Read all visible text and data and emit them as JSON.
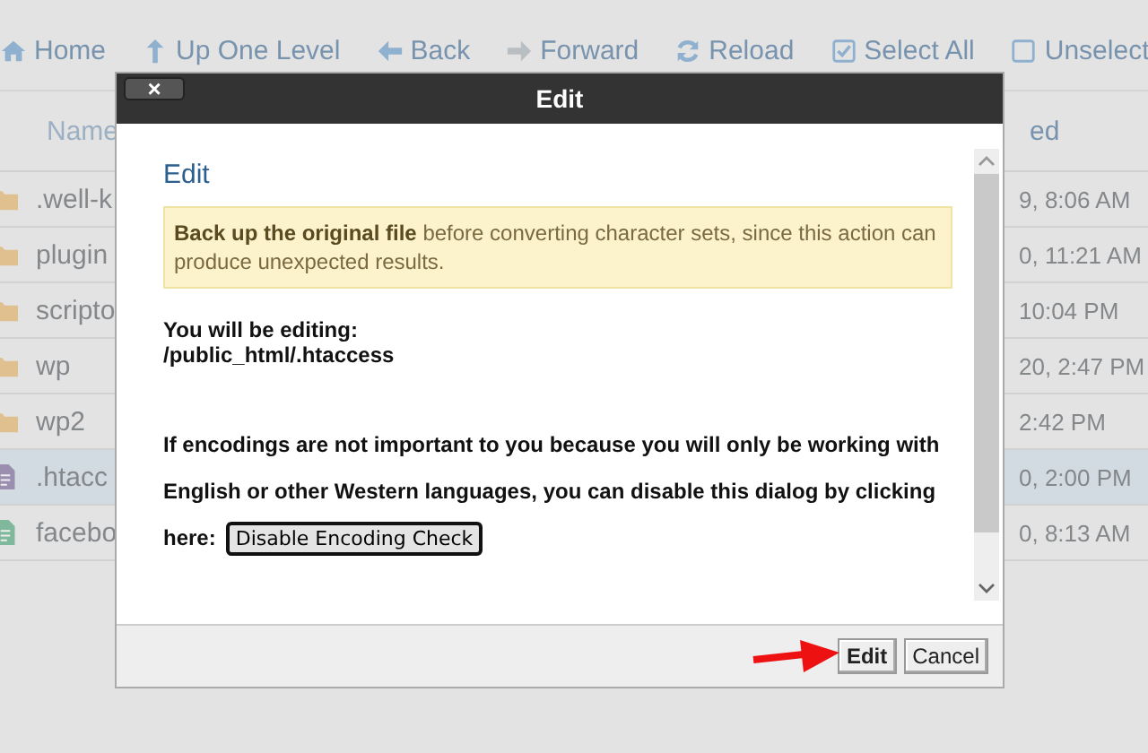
{
  "toolbar": [
    {
      "label": "Home"
    },
    {
      "label": "Up One Level"
    },
    {
      "label": "Back"
    },
    {
      "label": "Forward"
    },
    {
      "label": "Reload"
    },
    {
      "label": "Select All"
    },
    {
      "label": "Unselect"
    }
  ],
  "table": {
    "columns": [
      "Name",
      "ed"
    ],
    "rows": [
      {
        "kind": "folder",
        "name": ".well-k",
        "date": "9, 8:06 AM",
        "selected": false
      },
      {
        "kind": "folder",
        "name": "plugin",
        "date": "0, 11:21 AM",
        "selected": false
      },
      {
        "kind": "folder",
        "name": "scripto",
        "date": "10:04 PM",
        "selected": false
      },
      {
        "kind": "folder",
        "name": "wp",
        "date": "20, 2:47 PM",
        "selected": false
      },
      {
        "kind": "folder",
        "name": "wp2",
        "date": "2:42 PM",
        "selected": false
      },
      {
        "kind": "file",
        "color": "#9b8fb0",
        "name": ".htacc",
        "date": "0, 2:00 PM",
        "selected": true
      },
      {
        "kind": "file",
        "color": "#7fb89a",
        "name": "facebo",
        "date": "0, 8:13 AM",
        "selected": false
      }
    ]
  },
  "dialog": {
    "title": "Edit",
    "close": "×",
    "heading": "Edit",
    "notice": "**Back up the original file** before converting character sets, since this action can produce unexpected results.",
    "editing_label": "You will be editing:",
    "editing_path": "/public_html/.htaccess",
    "encoding_text": "If encodings are not important to you because you will only be working with English or other Western languages, you can disable this dialog by clicking",
    "encoding_text_end": "here:",
    "encoding_button": "Disable Encoding Check",
    "buttons": [
      {
        "label": "Edit",
        "primary": true
      },
      {
        "label": "Cancel",
        "primary": false
      }
    ]
  }
}
